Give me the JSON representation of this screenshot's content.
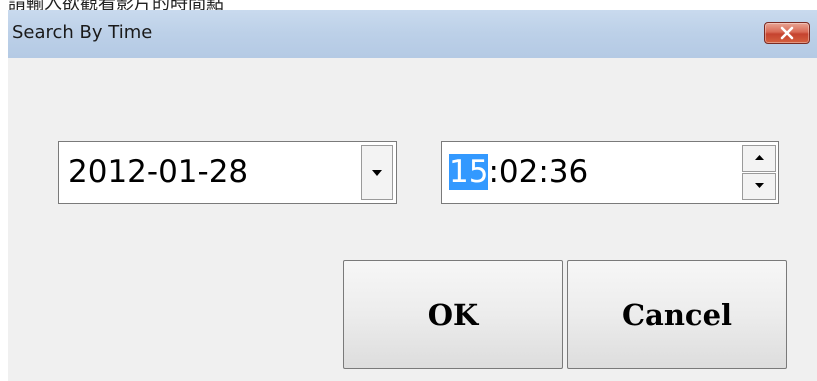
{
  "background_caption": "請輸入欲觀看影片的時間點",
  "dialog": {
    "title": "Search By Time",
    "close_icon": "close-x-icon"
  },
  "date_picker": {
    "value": "2012-01-28",
    "dropdown_icon": "chevron-down-icon"
  },
  "time_picker": {
    "hour": "15",
    "rest": ":02:36",
    "up_icon": "spin-up-icon",
    "down_icon": "spin-down-icon"
  },
  "buttons": {
    "ok_label": "OK",
    "cancel_label": "Cancel"
  },
  "colors": {
    "title_bar": "#bcd0e8",
    "close_button": "#c5432f",
    "selection": "#3399ff",
    "dialog_body": "#f0f0f0"
  }
}
